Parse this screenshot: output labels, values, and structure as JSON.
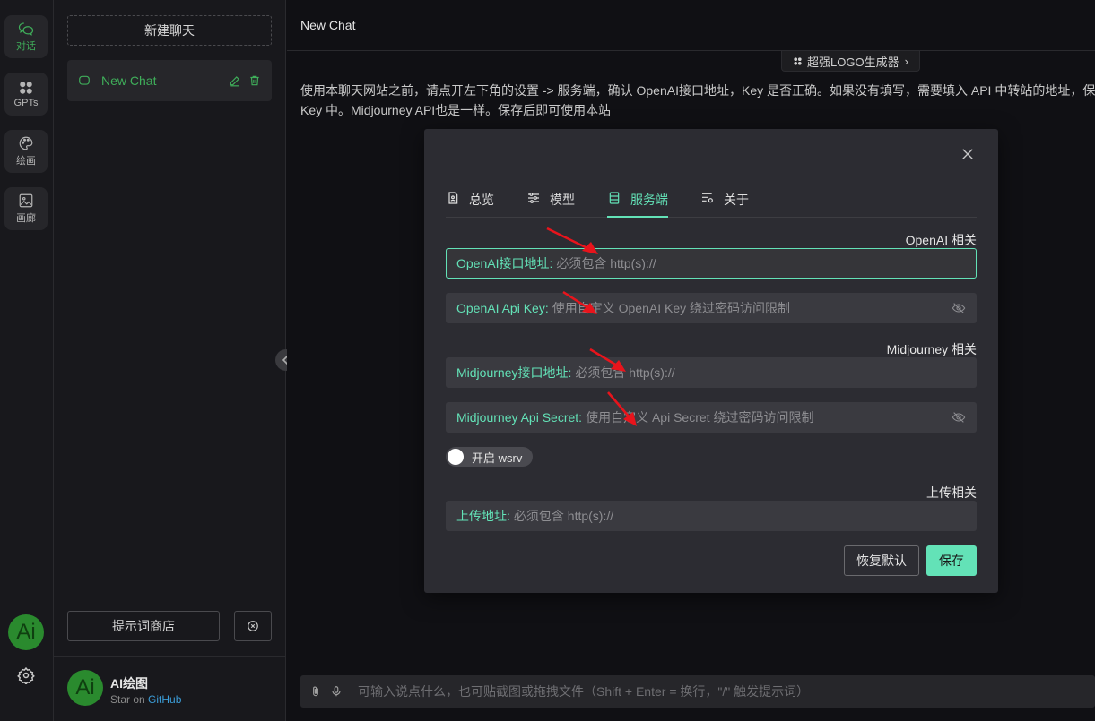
{
  "rail": {
    "items": [
      {
        "label": "对话",
        "icon": "chat-icon"
      },
      {
        "label": "GPTs",
        "icon": "grid-icon"
      },
      {
        "label": "绘画",
        "icon": "palette-icon"
      },
      {
        "label": "画廊",
        "icon": "image-icon"
      }
    ],
    "avatar_text": "Ai"
  },
  "sidebar": {
    "new_chat_label": "新建聊天",
    "chats": [
      {
        "title": "New Chat"
      }
    ],
    "prompt_store_label": "提示词商店",
    "user": {
      "avatar_text": "Ai",
      "name": "AI绘图",
      "sub_prefix": "Star on",
      "sub_link": "GitHub"
    }
  },
  "main": {
    "header_title": "New Chat",
    "logo_pill_label": "超强LOGO生成器",
    "notice_line1": "使用本聊天网站之前，请点开左下角的设置 -> 服务端，确认 OpenAI接口地址，Key 是否正确。如果没有填写，需要填入 API 中转站的地址，保",
    "notice_line2": "Key 中。Midjourney API也是一样。保存后即可使用本站",
    "input_placeholder": "可输入说点什么，也可贴截图或拖拽文件（Shift + Enter = 换行，\"/\" 触发提示词）"
  },
  "modal": {
    "tabs": [
      {
        "label": "总览",
        "icon": "file-icon"
      },
      {
        "label": "模型",
        "icon": "sliders-icon"
      },
      {
        "label": "服务端",
        "icon": "server-icon",
        "active": true
      },
      {
        "label": "关于",
        "icon": "info-list-icon"
      }
    ],
    "openai_section_title": "OpenAI 相关",
    "midjourney_section_title": "Midjourney 相关",
    "upload_section_title": "上传相关",
    "fields": {
      "openai_url": {
        "label": "OpenAI接口地址:",
        "placeholder": "必须包含 http(s)://",
        "value": ""
      },
      "openai_key": {
        "label": "OpenAI Api Key:",
        "placeholder": "使用自定义 OpenAI Key 绕过密码访问限制",
        "value": ""
      },
      "mj_url": {
        "label": "Midjourney接口地址:",
        "placeholder": "必须包含 http(s)://",
        "value": ""
      },
      "mj_secret": {
        "label": "Midjourney Api Secret:",
        "placeholder": "使用自定义 Api Secret 绕过密码访问限制",
        "value": ""
      },
      "upload_url": {
        "label": "上传地址:",
        "placeholder": "必须包含 http(s)://",
        "value": ""
      }
    },
    "wsrv_toggle_label": "开启 wsrv",
    "wsrv_enabled": false,
    "reset_label": "恢复默认",
    "save_label": "保存"
  },
  "colors": {
    "accent": "#63e2b7",
    "brand_green": "#3fae5a",
    "annotation_arrow": "#e8141c"
  }
}
